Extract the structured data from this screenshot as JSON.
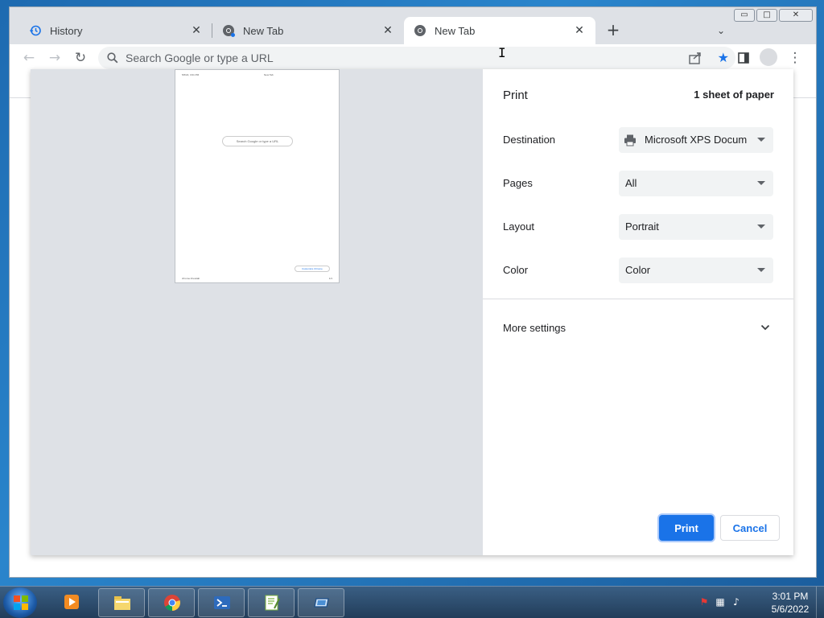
{
  "browser": {
    "tabs": [
      {
        "label": "History",
        "icon": "history-icon"
      },
      {
        "label": "New Tab",
        "icon": "chrome-icon"
      },
      {
        "label": "New Tab",
        "icon": "chrome-icon",
        "active": true
      }
    ],
    "omnibox": {
      "placeholder": "Search Google or type a URL",
      "value": ""
    },
    "window_controls": {
      "minimize": "▭",
      "maximize": "□",
      "close": "✕"
    }
  },
  "print_preview": {
    "page": {
      "header_left": "5/6/22, 3:01 PM",
      "header_center": "New Tab",
      "search_text": "Search Google or type a URL",
      "customize_text": "Customize Chrome",
      "footer_left": "chrome://newtab",
      "footer_right": "1/1"
    }
  },
  "print_settings": {
    "title": "Print",
    "sheets": "1 sheet of paper",
    "destination": {
      "label": "Destination",
      "value": "Microsoft XPS Docum"
    },
    "pages": {
      "label": "Pages",
      "value": "All"
    },
    "layout": {
      "label": "Layout",
      "value": "Portrait"
    },
    "color": {
      "label": "Color",
      "value": "Color"
    },
    "more_settings": "More settings",
    "print_button": "Print",
    "cancel_button": "Cancel"
  },
  "taskbar": {
    "clock_time": "3:01 PM",
    "clock_date": "5/6/2022",
    "apps": [
      "media-player-icon",
      "file-explorer-icon",
      "chrome-icon",
      "powershell-icon",
      "notepad-plus-icon",
      "remote-desktop-icon"
    ]
  },
  "colors": {
    "accent": "#1a73e8",
    "tabstrip": "#dee1e6",
    "preview_bg": "#dee1e6",
    "taskbar": "#2a4b6e"
  }
}
